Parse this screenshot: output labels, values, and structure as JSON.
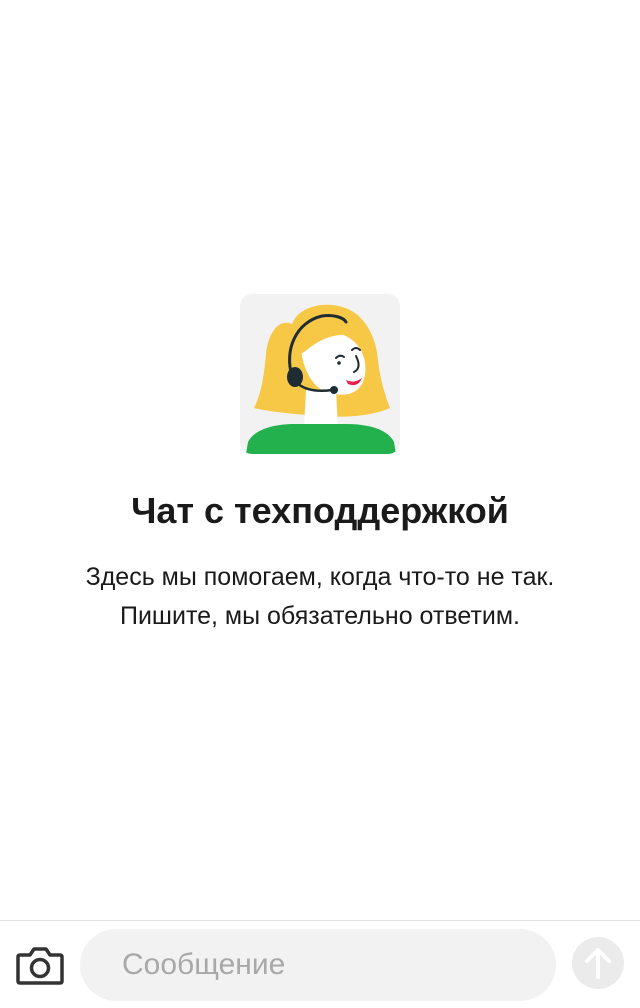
{
  "empty_state": {
    "title": "Чат с техподдержкой",
    "description_line1": "Здесь мы помогаем, когда что-то не так.",
    "description_line2": "Пишите, мы обязательно ответим."
  },
  "composer": {
    "placeholder": "Сообщение",
    "camera_icon": "camera-icon",
    "send_icon": "arrow-up-icon"
  },
  "colors": {
    "hair": "#f7c846",
    "shirt": "#22b14c",
    "card_bg": "#f2f2f2",
    "headset": "#1f2d33",
    "lips": "#e8204e"
  }
}
